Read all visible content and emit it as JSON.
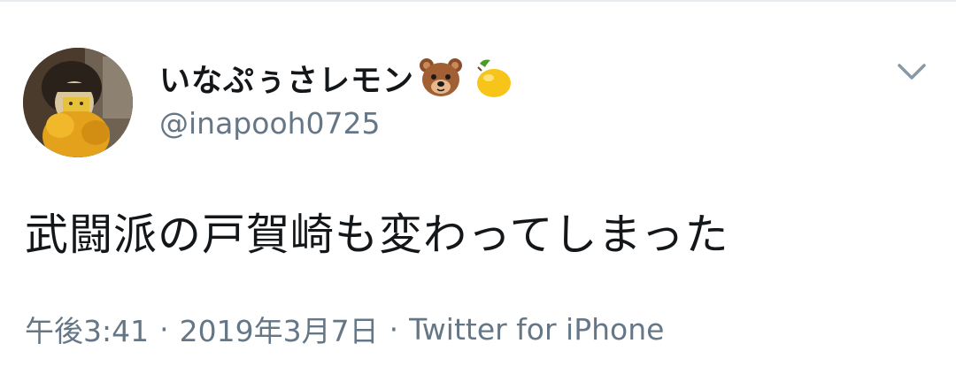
{
  "user": {
    "display_name": "いなぷぅさレモン",
    "display_name_emoji": [
      "bear-face-emoji",
      "lemon-emoji"
    ],
    "handle": "@inapooh0725",
    "avatar": "avatar"
  },
  "tweet": {
    "text": "武闘派の戸賀崎も変わってしまった"
  },
  "meta": {
    "time": "午後3:41",
    "separator": "·",
    "date": "2019年3月7日",
    "source": "Twitter for iPhone"
  },
  "icons": {
    "menu": "chevron-down-icon"
  },
  "colors": {
    "text_primary": "#14171a",
    "text_secondary": "#657786",
    "background": "#ffffff"
  }
}
